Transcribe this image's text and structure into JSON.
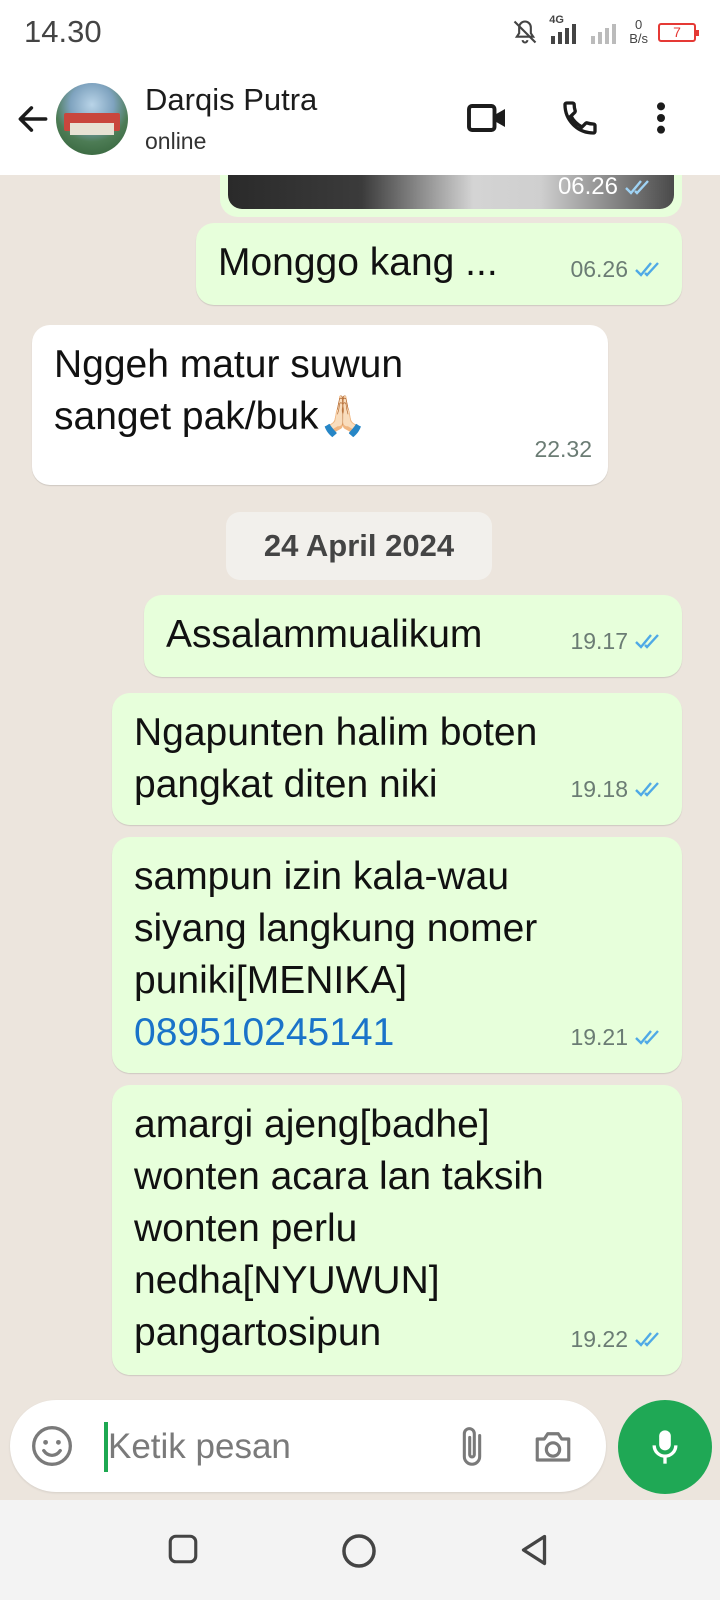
{
  "status_bar": {
    "time": "14.30",
    "network_label": "4G",
    "speed_value": "0",
    "speed_unit": "B/s",
    "battery": "7"
  },
  "header": {
    "contact_name": "Darqis Putra",
    "presence": "online"
  },
  "messages": [
    {
      "direction": "out",
      "type": "image",
      "time": "06.26"
    },
    {
      "direction": "out",
      "text": "Monggo kang ...",
      "time": "06.26"
    },
    {
      "direction": "in",
      "lines": [
        "Nggeh matur suwun",
        "sanget pak/buk"
      ],
      "emoji": "🙏🏻",
      "time": "22.32"
    },
    {
      "direction": "date",
      "text": "24 April 2024"
    },
    {
      "direction": "out",
      "text": "Assalammualikum",
      "time": "19.17"
    },
    {
      "direction": "out",
      "lines": [
        "Ngapunten halim boten",
        "pangkat diten niki"
      ],
      "time": "19.18"
    },
    {
      "direction": "out",
      "lines": [
        "sampun izin kala-wau",
        "siyang langkung nomer",
        "puniki[MENIKA]"
      ],
      "link": "089510245141",
      "time": "19.21"
    },
    {
      "direction": "out",
      "lines": [
        "amargi ajeng[badhe]",
        "wonten acara lan taksih",
        "wonten perlu",
        "nedha[NYUWUN]",
        "pangartosipun"
      ],
      "time": "19.22"
    }
  ],
  "input": {
    "placeholder": "Ketik pesan",
    "value": ""
  },
  "colors": {
    "outgoing_bubble": "#e7ffdb",
    "incoming_bubble": "#ffffff",
    "chat_background": "#ece5dd",
    "accent_green": "#1fa855",
    "read_tick_blue": "#4fa9e6",
    "link_blue": "#1a73c9"
  },
  "icons": {
    "back": "arrow-left-icon",
    "video": "video-camera-icon",
    "call": "phone-icon",
    "menu": "more-vertical-icon",
    "emoji": "emoji-icon",
    "attach": "paperclip-icon",
    "camera": "camera-icon",
    "mic": "microphone-icon",
    "nav_recents": "square-icon",
    "nav_home": "circle-icon",
    "nav_back": "triangle-back-icon"
  }
}
